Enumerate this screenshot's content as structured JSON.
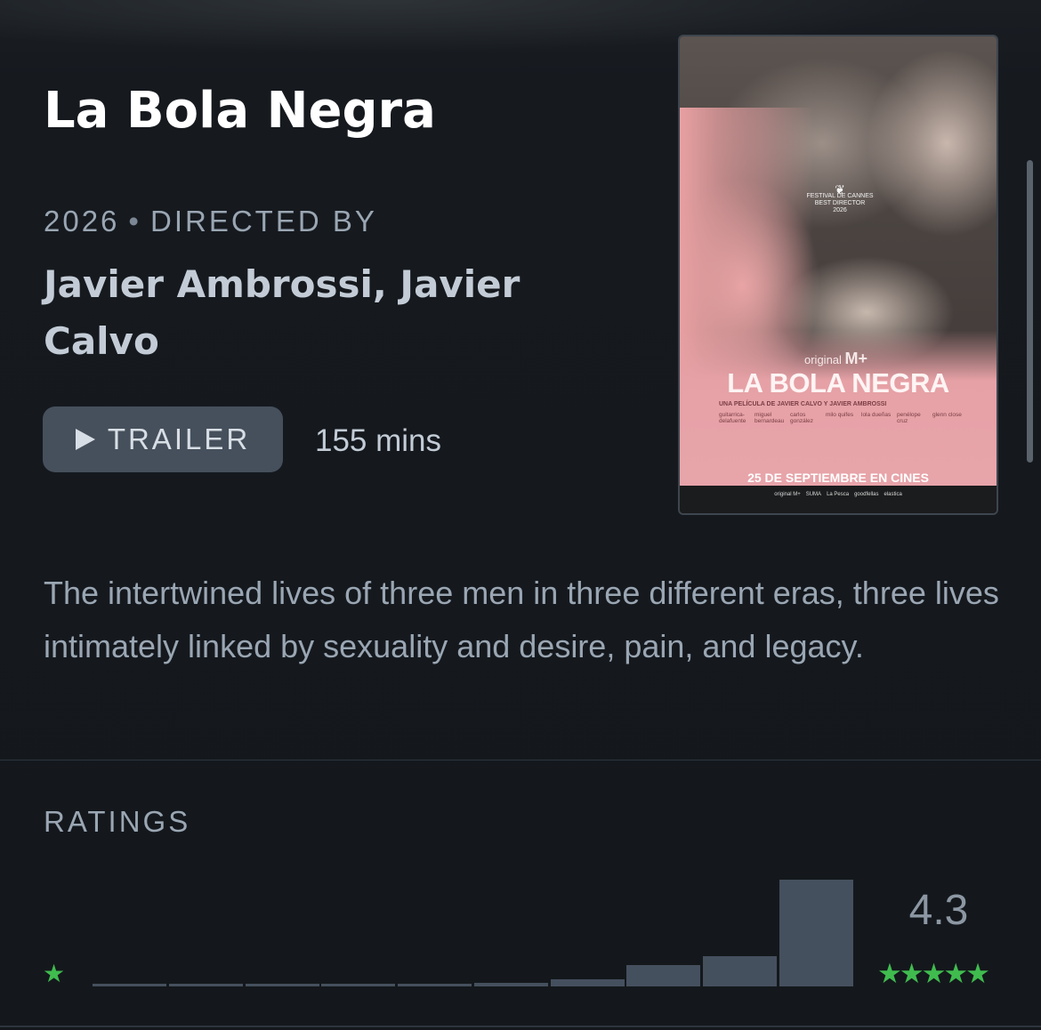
{
  "film": {
    "title": "La Bola Negra",
    "year": "2026",
    "directed_by_label": "DIRECTED BY",
    "directors": "Javier Ambrossi, Javier Calvo",
    "trailer_label": "TRAILER",
    "runtime": "155 mins",
    "synopsis": "The intertwined lives of three men in three different eras, three lives intimately linked by sexuality and desire, pain, and legacy."
  },
  "poster": {
    "festival": "FESTIVAL DE CANNES",
    "award": "BEST DIRECTOR",
    "festival_year": "2026",
    "brand": "original",
    "brand_mark": "M+",
    "title": "LA BOLA NEGRA",
    "subtitle": "UNA PELÍCULA DE JAVIER CALVO Y JAVIER AMBROSSI",
    "cast": [
      "guitarrica-delafuente",
      "miguel bernardeau",
      "carlos gonzález",
      "milo quifes",
      "lola dueñas",
      "penélope cruz",
      "glenn close"
    ],
    "release": "25 DE SEPTIEMBRE EN CINES",
    "logos": [
      "original M+",
      "SUMA",
      "La Pesca",
      "goodfellas",
      "elastica"
    ]
  },
  "ratings": {
    "label": "RATINGS",
    "average": "4.3",
    "stars_big": "★★★★★",
    "star_small": "★",
    "distribution": [
      0.02,
      0.02,
      0.02,
      0.02,
      0.02,
      0.03,
      0.07,
      0.2,
      0.28,
      1.0
    ]
  },
  "colors": {
    "background": "#14181c",
    "accent_green": "#40bc4f",
    "bar": "#45505e",
    "button": "#46505c"
  }
}
